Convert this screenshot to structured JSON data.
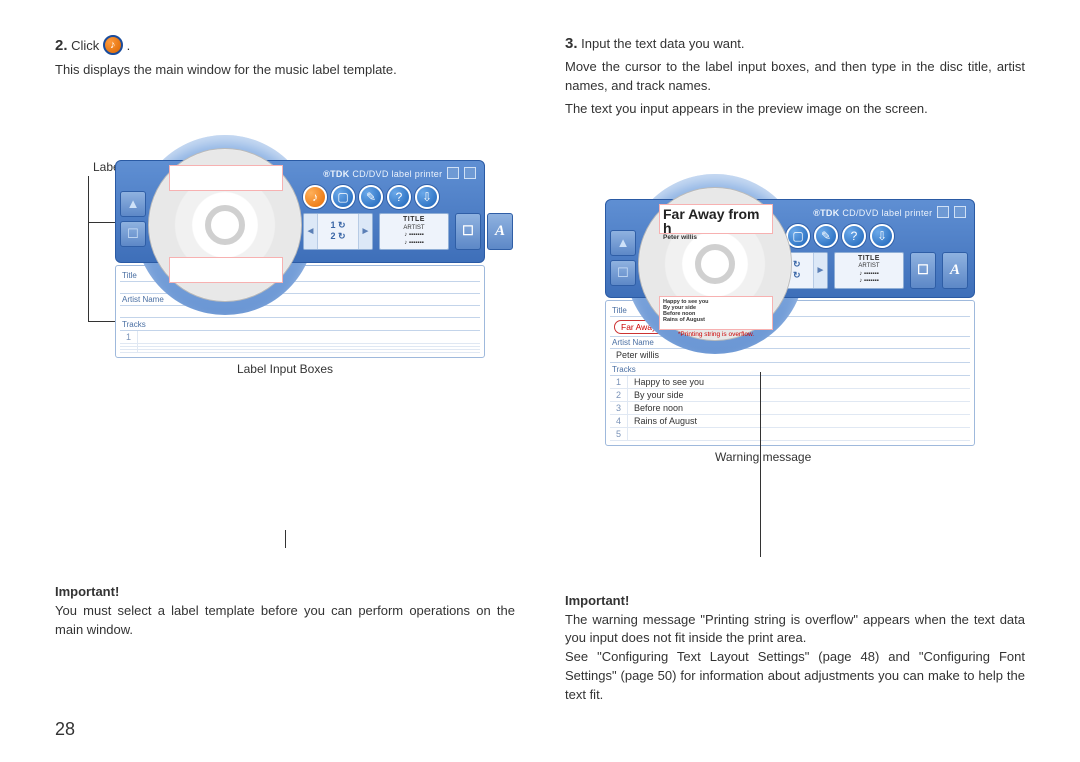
{
  "page_number": "28",
  "left": {
    "step_number": "2.",
    "step_text": "Click",
    "desc": "This displays the main window for the music label template.",
    "callout_preview": "Label Preview Image",
    "callout_inputs": "Label Input Boxes",
    "important_label": "Important!",
    "important_text": "You must select a label template before you can perform operations on the main window."
  },
  "right": {
    "step_number": "3.",
    "step_text": "Input the text data you want.",
    "desc1": "Move the cursor to the label input boxes, and then type in the disc title, artist names, and track names.",
    "desc2": "The text you input appears in the preview image on the screen.",
    "callout_warning": "Warning message",
    "important_label": "Important!",
    "important_text": "The warning message \"Printing string is overflow\" appears when the text data you input does not fit inside the print area.\nSee \"Configuring Text Layout Settings\" (page 48) and \"Configuring Font Settings\" (page 50) for information about adjustments you can make to help the text fit."
  },
  "app": {
    "titlebar_brand": "®TDK",
    "titlebar_text": "CD/DVD label printer",
    "nav1": "1",
    "nav2": "2",
    "layout_l1": "TITLE",
    "layout_l2": "ARTIST",
    "field_title_label": "Title",
    "field_artist_label": "Artist Name",
    "field_tracks_label": "Tracks"
  },
  "left_fields": {
    "title": "",
    "artist": "",
    "tracks": [
      {
        "n": "1",
        "t": ""
      }
    ]
  },
  "right_fields": {
    "cd_title": "Far Away from h",
    "cd_artist": "Peter willis",
    "cd_tracks": "Happy to see you\nBy your side\nBefore noon\nRains of August",
    "warn": "*Printing string is overflow.",
    "title_value": "Far Away from here",
    "artist_value": "Peter willis",
    "tracks": [
      {
        "n": "1",
        "t": "Happy to see you"
      },
      {
        "n": "2",
        "t": "By your side"
      },
      {
        "n": "3",
        "t": "Before noon"
      },
      {
        "n": "4",
        "t": "Rains of August"
      },
      {
        "n": "5",
        "t": ""
      }
    ]
  }
}
